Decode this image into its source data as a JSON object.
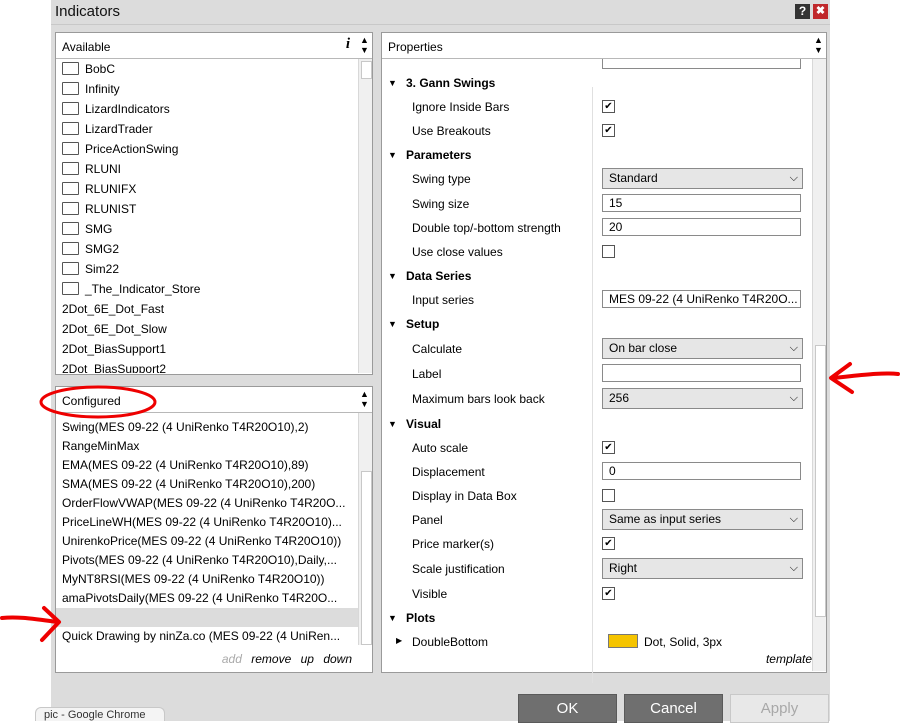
{
  "window": {
    "title": "Indicators",
    "help_glyph": "?",
    "close_glyph": "✖"
  },
  "available": {
    "header": "Available",
    "info_glyph": "i",
    "items": [
      {
        "label": "BobC",
        "folder": true
      },
      {
        "label": "Infinity",
        "folder": true
      },
      {
        "label": "LizardIndicators",
        "folder": true
      },
      {
        "label": "LizardTrader",
        "folder": true
      },
      {
        "label": "PriceActionSwing",
        "folder": true
      },
      {
        "label": "RLUNI",
        "folder": true
      },
      {
        "label": "RLUNIFX",
        "folder": true
      },
      {
        "label": "RLUNIST",
        "folder": true
      },
      {
        "label": "SMG",
        "folder": true
      },
      {
        "label": "SMG2",
        "folder": true
      },
      {
        "label": "Sim22",
        "folder": true
      },
      {
        "label": "_The_Indicator_Store",
        "folder": true
      },
      {
        "label": "2Dot_6E_Dot_Fast",
        "folder": false
      },
      {
        "label": "2Dot_6E_Dot_Slow",
        "folder": false
      },
      {
        "label": "2Dot_BiasSupport1",
        "folder": false
      },
      {
        "label": "2Dot_BiasSupport2",
        "folder": false
      }
    ]
  },
  "configured": {
    "header": "Configured",
    "items": [
      "Swing(MES 09-22 (4 UniRenko T4R20O10),2)",
      "RangeMinMax",
      "EMA(MES 09-22 (4 UniRenko T4R20O10),89)",
      "SMA(MES 09-22 (4 UniRenko T4R20O10),200)",
      "OrderFlowVWAP(MES 09-22 (4 UniRenko T4R20O...",
      "PriceLineWH(MES 09-22 (4 UniRenko T4R20O10)...",
      "UnirenkoPrice(MES 09-22 (4 UniRenko T4R20O10))",
      "Pivots(MES 09-22 (4 UniRenko T4R20O10),Daily,...",
      "MyNT8RSI(MES 09-22 (4 UniRenko T4R20O10))",
      "amaPivotsDaily(MES 09-22 (4 UniRenko T4R20O...",
      "",
      "Quick Drawing by ninZa.co (MES 09-22 (4 UniRen..."
    ],
    "selected_index": 10,
    "links": {
      "add": "add",
      "remove": "remove",
      "up": "up",
      "down": "down"
    }
  },
  "properties": {
    "header": "Properties",
    "template_link": "template",
    "categories": {
      "gann": "3. Gann Swings",
      "parameters": "Parameters",
      "data_series": "Data Series",
      "setup": "Setup",
      "visual": "Visual",
      "plots": "Plots"
    },
    "rows": {
      "ignore_inside_bars": {
        "label": "Ignore Inside Bars",
        "checked": true
      },
      "use_breakouts": {
        "label": "Use Breakouts",
        "checked": true
      },
      "swing_type": {
        "label": "Swing type",
        "value": "Standard"
      },
      "swing_size": {
        "label": "Swing size",
        "value": "15"
      },
      "double_top": {
        "label": "Double top/-bottom strength",
        "value": "20"
      },
      "use_close_values": {
        "label": "Use close values",
        "checked": false
      },
      "input_series": {
        "label": "Input series",
        "value": "MES 09-22 (4 UniRenko T4R20O..."
      },
      "calculate": {
        "label": "Calculate",
        "value": "On bar close"
      },
      "label": {
        "label": "Label",
        "value": ""
      },
      "max_bars": {
        "label": "Maximum bars look back",
        "value": "256"
      },
      "auto_scale": {
        "label": "Auto scale",
        "checked": true
      },
      "displacement": {
        "label": "Displacement",
        "value": "0"
      },
      "display_in_data_box": {
        "label": "Display in Data Box",
        "checked": false
      },
      "panel": {
        "label": "Panel",
        "value": "Same as input series"
      },
      "price_markers": {
        "label": "Price marker(s)",
        "checked": true
      },
      "scale_justification": {
        "label": "Scale justification",
        "value": "Right"
      },
      "visible": {
        "label": "Visible",
        "checked": true
      },
      "double_bottom": {
        "label": "DoubleBottom",
        "value": "Dot, Solid, 3px",
        "color": "#f5c400"
      }
    }
  },
  "buttons": {
    "ok": "OK",
    "cancel": "Cancel",
    "apply": "Apply"
  },
  "taskbar": {
    "chrome_tab": "pic - Google Chrome"
  },
  "annotations": {
    "ink_color": "#ee0000"
  }
}
